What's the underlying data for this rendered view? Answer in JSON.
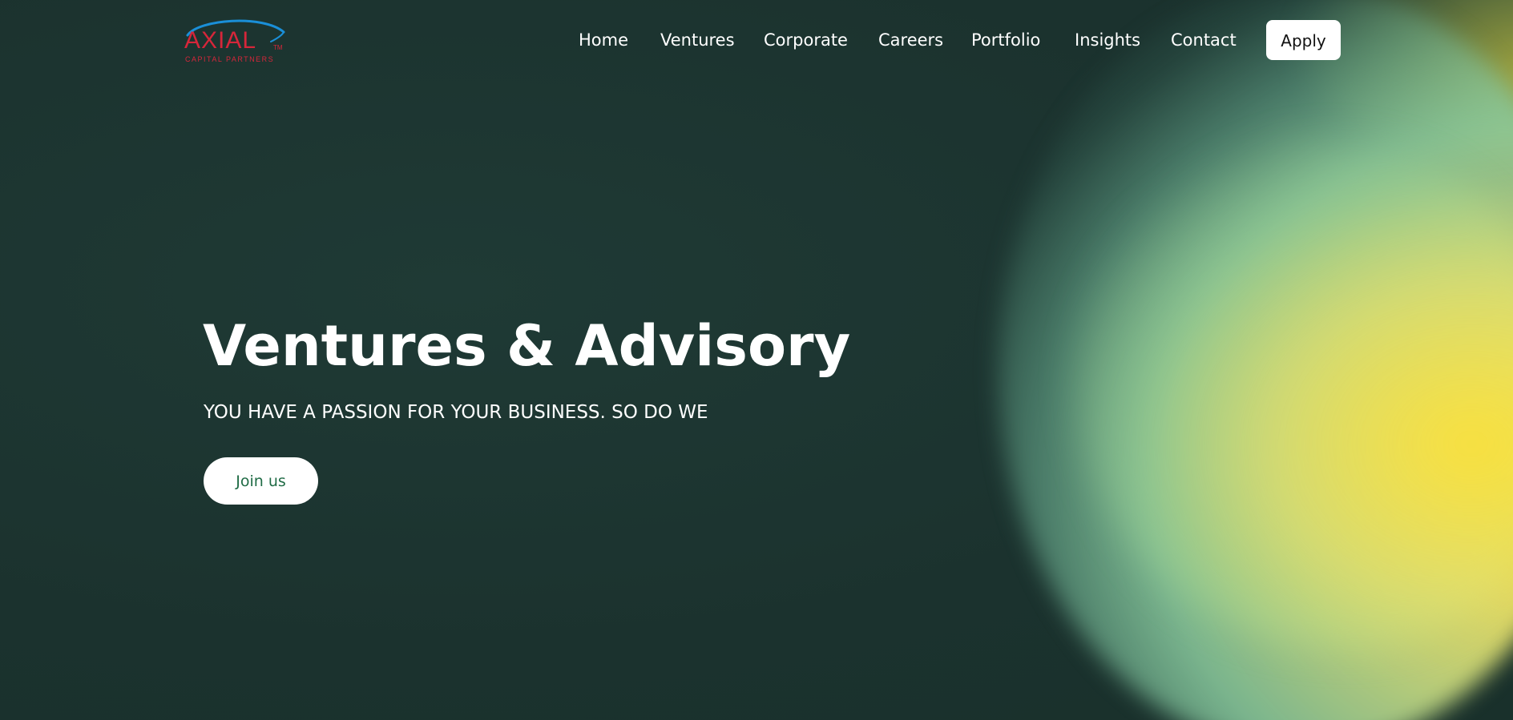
{
  "brand": {
    "name": "AXIAL",
    "tagline": "CAPITAL PARTNERS",
    "trademark": "TM",
    "logo_red": "#d6263a",
    "logo_blue": "#1a8fd8"
  },
  "nav": {
    "items": [
      {
        "label": "Home"
      },
      {
        "label": "Ventures"
      },
      {
        "label": "Corporate"
      },
      {
        "label": "Careers"
      },
      {
        "label": "Portfolio"
      },
      {
        "label": "Insights"
      },
      {
        "label": "Contact"
      }
    ],
    "apply_label": "Apply"
  },
  "hero": {
    "title": "Ventures & Advisory",
    "subtitle": "YOU HAVE A PASSION FOR YOUR BUSINESS. SO DO WE",
    "cta_label": "Join us"
  },
  "colors": {
    "background": "#1c3430",
    "accent_yellow": "#fade32",
    "accent_mint": "#8ccda0",
    "cta_text": "#1f6b45"
  }
}
